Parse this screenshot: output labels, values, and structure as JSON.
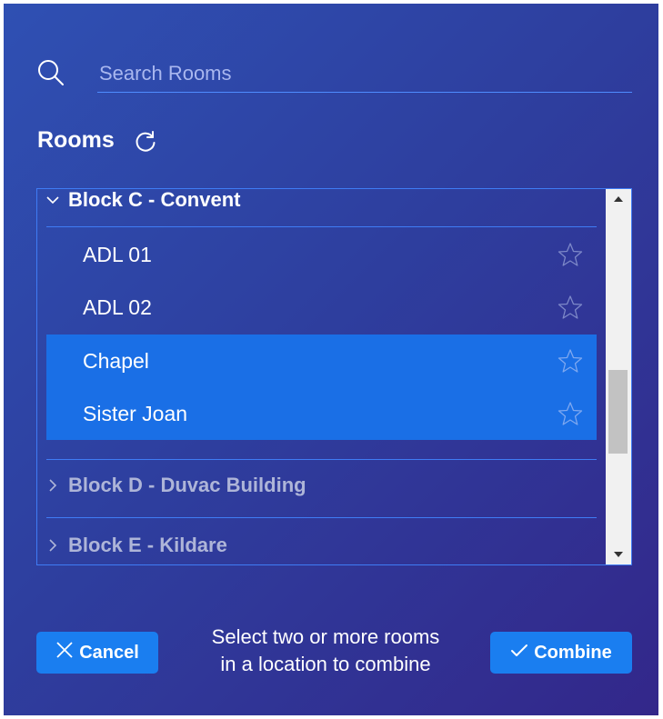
{
  "search": {
    "placeholder": "Search Rooms",
    "value": ""
  },
  "rooms": {
    "title": "Rooms"
  },
  "groups": [
    {
      "label": "Block C - Convent",
      "expanded": true,
      "rooms": [
        {
          "label": "ADL 01",
          "selected": false
        },
        {
          "label": "ADL 02",
          "selected": false
        },
        {
          "label": "Chapel",
          "selected": true
        },
        {
          "label": "Sister Joan",
          "selected": true
        }
      ]
    },
    {
      "label": "Block D - Duvac Building",
      "expanded": false
    },
    {
      "label": "Block E - Kildare",
      "expanded": false
    }
  ],
  "scroll": {
    "thumb_start": 0.48,
    "thumb_end": 0.73
  },
  "footer": {
    "cancel_label": "Cancel",
    "combine_label": "Combine",
    "hint_line1": "Select two or more rooms",
    "hint_line2": "in a location to combine"
  },
  "colors": {
    "selected_row": "#1a6fe6",
    "button": "#1a7ef0",
    "divider": "#3f7cf5"
  },
  "icons": {
    "search": "search-icon",
    "refresh": "refresh-icon",
    "favorite": "star-outline-icon",
    "expand": "chevron-down-icon",
    "collapse": "chevron-right-icon",
    "cancel": "close-icon",
    "combine": "check-icon"
  }
}
